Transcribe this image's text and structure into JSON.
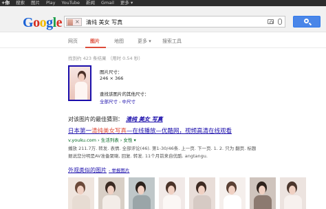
{
  "topbar": {
    "items": [
      "+你",
      "搜索",
      "图片",
      "Play",
      "YouTube",
      "新闻",
      "Gmail",
      "更多 ▾"
    ]
  },
  "header": {
    "logo": [
      "G",
      "o",
      "o",
      "g",
      "l",
      "e"
    ],
    "query": "清纯 美女 写真",
    "chip_close": "×"
  },
  "tabs": [
    {
      "label": "网页"
    },
    {
      "label": "图片"
    },
    {
      "label": "地图"
    },
    {
      "label": "更多 ▾"
    },
    {
      "label": "搜索工具"
    }
  ],
  "stats": "找到约 423 条结果  （用时 0.54 秒）",
  "image_info": {
    "size_label": "图片尺寸：",
    "size_value": "246 × 366",
    "other_sizes_label": "查找该图片的其他尺寸：",
    "all_sizes": "全部尺寸",
    "separator": " - ",
    "medium_sizes": "中尺寸"
  },
  "best_guess": {
    "label": "对该图片的最佳猜测：",
    "value": "清纯 美女 写真"
  },
  "result": {
    "title_pre": "日本第一",
    "title_em": "清纯美女写真",
    "title_post": "—在线播放—优酷网，视频高清在线观看",
    "url": "v.youku.com › 生活列表 › 女性 ▾",
    "snippet_1": "播放 211.7万. 转发. 表情. 全部评论(46). 第1-30/46条. 上一页. 下一页. 1. 2. 只为 翻页. 标题",
    "snippet_2": "据说您分明是AV准备聚喇, 回复. 转发. 11个月前来自优酷. angtangu."
  },
  "similar": {
    "label": "外观类似的图片",
    "report": "- 举报图片"
  },
  "colors": {
    "accent_red": "#dd4b39",
    "link_blue": "#1a0dab",
    "url_green": "#006621",
    "search_button": "#4a86e8"
  }
}
